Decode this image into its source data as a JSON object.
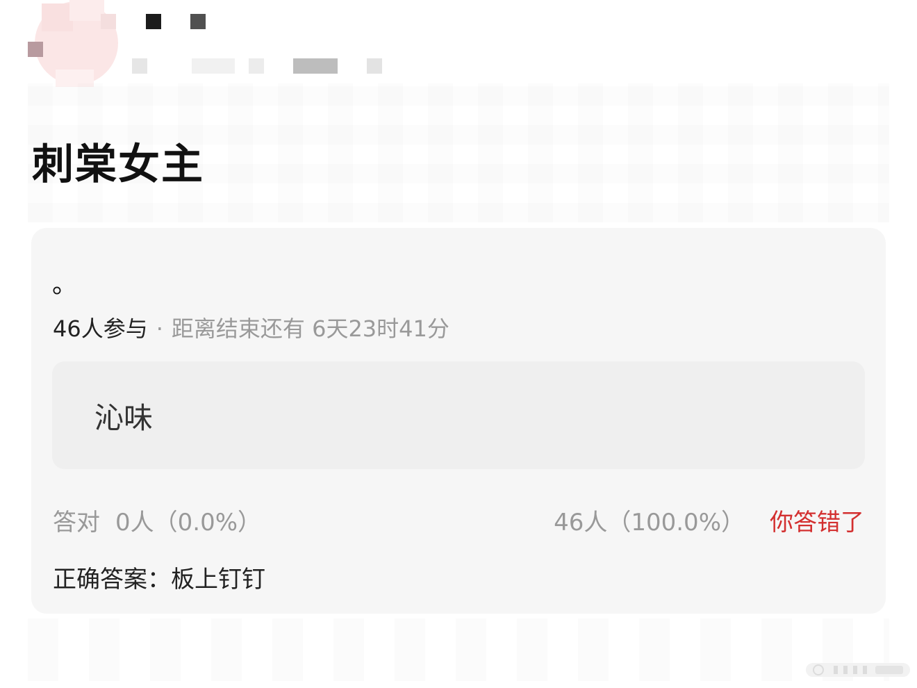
{
  "post": {
    "title": "刺棠女主"
  },
  "quiz": {
    "question": "。",
    "participants": "46人参与",
    "separator": "·",
    "countdown": "距离结束还有 6天23时41分",
    "option": "沁味",
    "correct_label": "答对",
    "correct_value": "0人（0.0%）",
    "wrong_value": "46人（100.0%）",
    "verdict": "你答错了",
    "answer_label": "正确答案：",
    "answer_value": "板上钉钉"
  },
  "colors": {
    "verdict": "#d32f2f",
    "card_bg": "#f6f6f6",
    "option_bg": "#efefef",
    "muted_text": "#999999"
  },
  "icons": {
    "avatar": "pixelated-avatar-icon",
    "watermark": "weibo-watermark-icon"
  }
}
